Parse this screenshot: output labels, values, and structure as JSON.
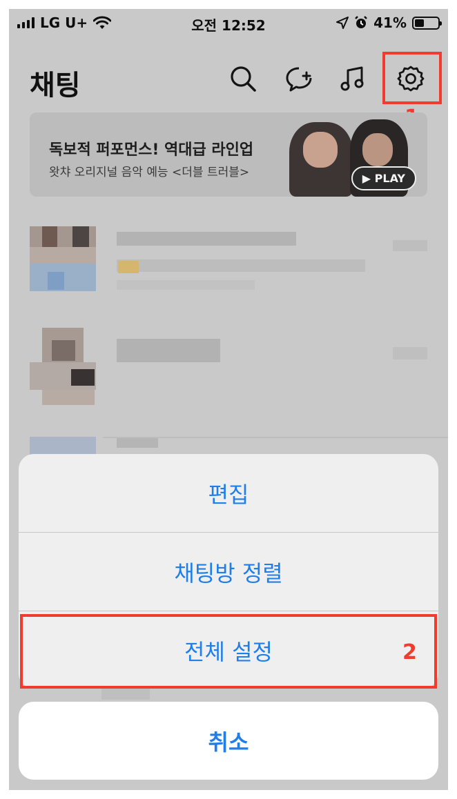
{
  "status_bar": {
    "carrier": "LG U+",
    "time": "오전 12:52",
    "battery": "41%",
    "battery_level": 0.41,
    "icons": [
      "signal-icon",
      "wifi-icon",
      "location-arrow-icon",
      "alarm-icon",
      "battery-icon"
    ]
  },
  "header": {
    "title": "채팅",
    "icons": [
      "search-icon",
      "new-chat-icon",
      "music-icon",
      "settings-icon"
    ]
  },
  "banner": {
    "title": "독보적 퍼포먼스! 역대급 라인업",
    "subtitle": "왓챠 오리지널 음악 예능 <더블 트러블>",
    "play_label": "PLAY"
  },
  "action_sheet": {
    "items": [
      "편집",
      "채팅방 정렬",
      "전체 설정"
    ],
    "cancel": "취소"
  },
  "annotations": {
    "marker_1": "1",
    "marker_2": "2",
    "color": "#f03c2e"
  },
  "colors": {
    "accent_blue": "#1f7ee8",
    "overlay": "#c9c9c9"
  }
}
